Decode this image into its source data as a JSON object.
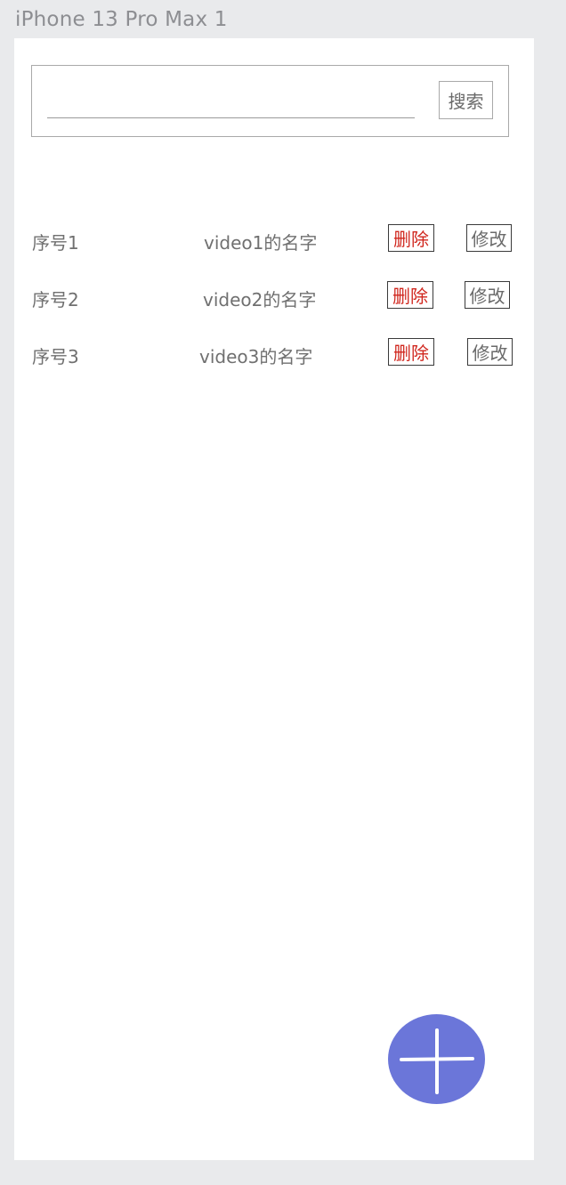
{
  "window": {
    "frame_title": "iPhone 13 Pro Max 1"
  },
  "search": {
    "value": "",
    "placeholder": "",
    "button_label": "搜索"
  },
  "list": {
    "items": [
      {
        "index": "序号1",
        "name": "video1的名字",
        "delete_label": "删除",
        "edit_label": "修改"
      },
      {
        "index": "序号2",
        "name": "video2的名字",
        "delete_label": "删除",
        "edit_label": "修改"
      },
      {
        "index": "序号3",
        "name": "video3的名字",
        "delete_label": "删除",
        "edit_label": "修改"
      }
    ]
  },
  "fab": {
    "icon": "plus-icon",
    "color": "#6b76d9"
  },
  "colors": {
    "background": "#e9eaec",
    "delete_text": "#d0261d",
    "text": "#707070"
  }
}
